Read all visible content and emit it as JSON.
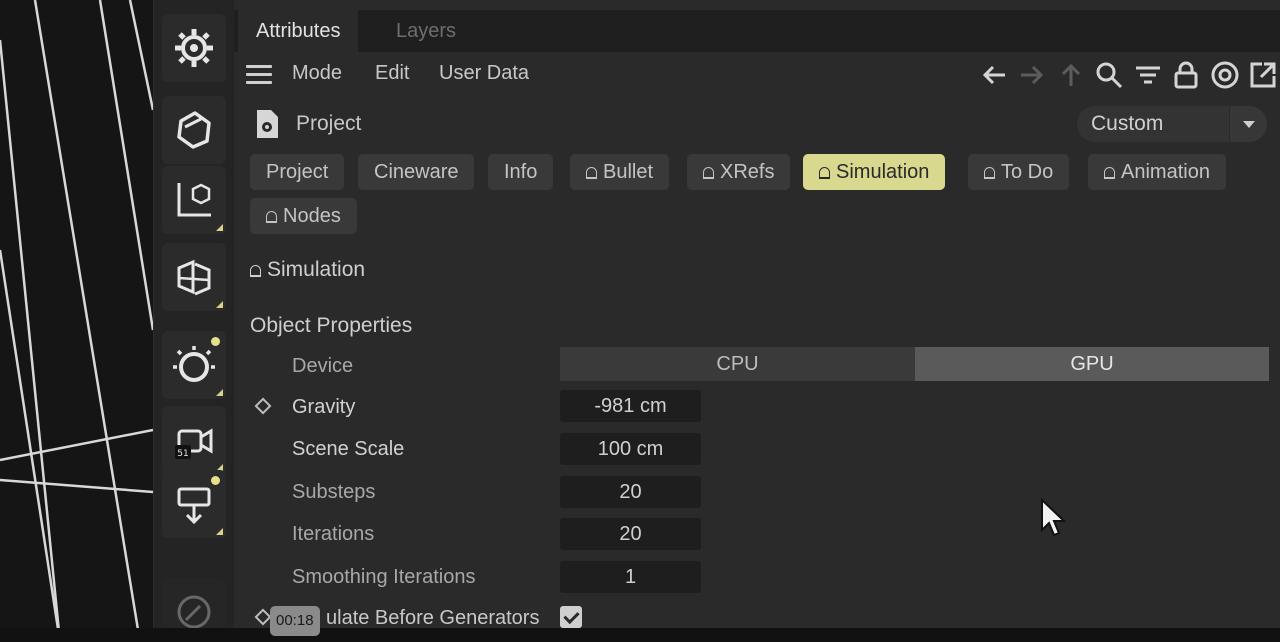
{
  "panel_tabs": {
    "attributes": "Attributes",
    "layers": "Layers"
  },
  "menu": {
    "mode": "Mode",
    "edit": "Edit",
    "user_data": "User Data"
  },
  "nav_icons": [
    "back-arrow-icon",
    "forward-arrow-icon",
    "up-arrow-icon",
    "search-icon",
    "filter-icon",
    "lock-icon",
    "target-icon",
    "open-external-icon"
  ],
  "project": {
    "title": "Project",
    "preset": "Custom"
  },
  "chips": {
    "project": "Project",
    "cineware": "Cineware",
    "info": "Info",
    "bullet": "Bullet",
    "xrefs": "XRefs",
    "simulation": "Simulation",
    "todo": "To Do",
    "animation": "Animation",
    "nodes": "Nodes"
  },
  "section": {
    "group": "Simulation",
    "object_properties": "Object Properties"
  },
  "properties": {
    "device": {
      "label": "Device",
      "options": [
        "CPU",
        "GPU"
      ],
      "selected": "GPU"
    },
    "gravity": {
      "label": "Gravity",
      "value": "-981 cm"
    },
    "scene_scale": {
      "label": "Scene Scale",
      "value": "100 cm"
    },
    "substeps": {
      "label": "Substeps",
      "value": "20"
    },
    "iterations": {
      "label": "Iterations",
      "value": "20"
    },
    "smoothing_iterations": {
      "label": "Smoothing Iterations",
      "value": "1"
    },
    "simulate_before_generators": {
      "label": "ulate Before Generators",
      "checked": true
    }
  },
  "timeline": {
    "time": "00:18"
  },
  "colors": {
    "accent": "#d9d88f",
    "panel_bg": "#2a2a2a",
    "field_bg": "#1e1e1e"
  }
}
